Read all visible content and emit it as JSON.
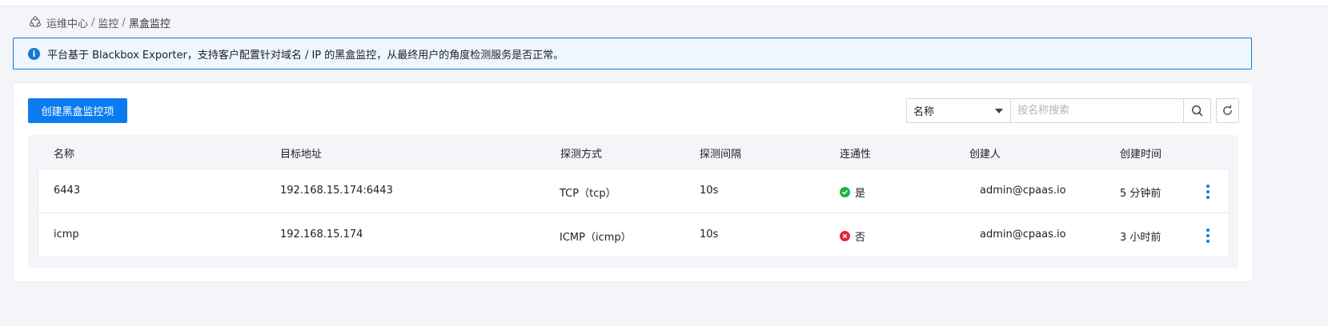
{
  "breadcrumb": {
    "icon": "ops-center-icon",
    "items": [
      "运维中心",
      "监控",
      "黑盒监控"
    ],
    "separator": "/"
  },
  "alert": {
    "icon": "info-icon",
    "text": "平台基于 Blackbox Exporter，支持客户配置针对域名 / IP 的黑盒监控，从最终用户的角度检测服务是否正常。"
  },
  "toolbar": {
    "create_label": "创建黑盒监控项",
    "filter_select_value": "名称",
    "search_placeholder": "按名称搜索"
  },
  "table": {
    "columns": [
      "名称",
      "目标地址",
      "探测方式",
      "探测间隔",
      "连通性",
      "创建人",
      "创建时间"
    ],
    "rows": [
      {
        "name": "6443",
        "target": "192.168.15.174:6443",
        "method": "TCP（tcp）",
        "interval": "10s",
        "connectivity": "是",
        "connectivity_status": "ok",
        "creator": "admin@cpaas.io",
        "created": "5 分钟前"
      },
      {
        "name": "icmp",
        "target": "192.168.15.174",
        "method": "ICMP（icmp）",
        "interval": "10s",
        "connectivity": "否",
        "connectivity_status": "error",
        "creator": "admin@cpaas.io",
        "created": "3 小时前"
      }
    ]
  },
  "colors": {
    "primary": "#0a7cf0",
    "alert_border": "#1676d8",
    "alert_bg": "#eef6ff",
    "status_ok": "#22b33f",
    "status_error": "#e5263b"
  }
}
